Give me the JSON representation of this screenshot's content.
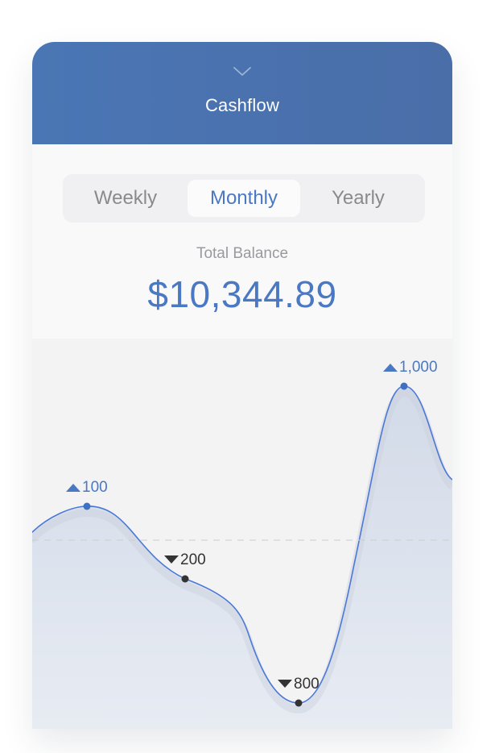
{
  "header": {
    "title": "Cashflow",
    "collapse_icon": "chevron-down-icon"
  },
  "tabs": [
    {
      "label": "Weekly",
      "active": false
    },
    {
      "label": "Monthly",
      "active": true
    },
    {
      "label": "Yearly",
      "active": false
    }
  ],
  "balance": {
    "label": "Total Balance",
    "value": "$10,344.89"
  },
  "colors": {
    "accent": "#4a78c2",
    "header": "#4a6ea8",
    "down": "#333333"
  },
  "chart_data": {
    "type": "area",
    "points": [
      {
        "label": "100",
        "value": 100,
        "direction": "up"
      },
      {
        "label": "200",
        "value": -200,
        "direction": "down"
      },
      {
        "label": "800",
        "value": -800,
        "direction": "down"
      },
      {
        "label": "1,000",
        "value": 1000,
        "direction": "up"
      }
    ],
    "baseline": 0,
    "ylim": [
      -800,
      1000
    ]
  }
}
